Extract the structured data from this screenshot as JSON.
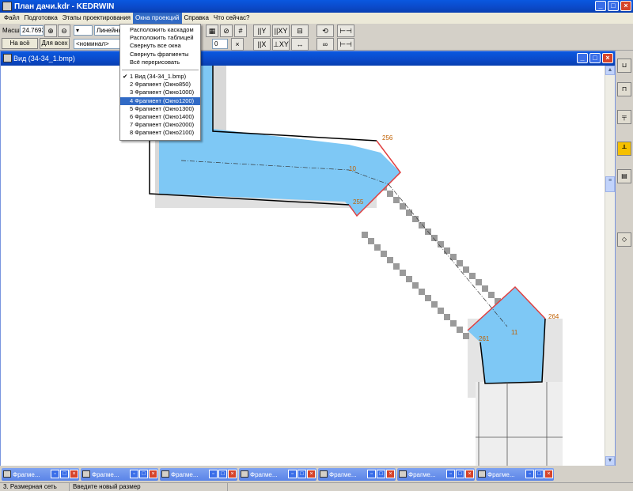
{
  "app": {
    "title": "План дачи.kdr - KEDRWIN"
  },
  "menu": [
    "Файл",
    "Подготовка",
    "Этапы проектирования",
    "Окна проекций",
    "Справка",
    "Что сейчас?"
  ],
  "toolbar": {
    "scale_label": "Масшт",
    "scale_value": "24.7693",
    "btn_all_window": "На всё окно",
    "btn_for_all": "Для всех",
    "linetype": "Линейный",
    "nominal": "<номинал>",
    "zero_value": "0"
  },
  "dropdown": {
    "items": [
      "Расположить каскадом",
      "Расположить таблицей",
      "Свернуть все окна",
      "Свернуть фрагменты",
      "Всё перерисовать"
    ],
    "windows": [
      "1 Вид (34-34_1.bmp)",
      "2 Фрагмент (Окно850)",
      "3 Фрагмент (Окно1000)",
      "4 Фрагмент (Окно1200)",
      "5 Фрагмент (Окно1300)",
      "6 Фрагмент (Окно1400)",
      "7 Фрагмент (Окно2000)",
      "8 Фрагмент (Окно2100)"
    ],
    "checked_index": 0,
    "selected_index": 3
  },
  "child_window": {
    "title": "Вид (34-34_1.bmp)"
  },
  "drawing": {
    "labels": [
      "256",
      "10",
      "255",
      "11",
      "264",
      "261"
    ]
  },
  "taskbar": {
    "items": [
      "Фрагме...",
      "Фрагме...",
      "Фрагме...",
      "Фрагме...",
      "Фрагме...",
      "Фрагме...",
      "Фрагме..."
    ]
  },
  "status": {
    "left": "3. Размерная сеть",
    "right": "Введите новый размер"
  },
  "colors": {
    "titlebar": "#0b49c8",
    "fill_blue": "#7ec8f5",
    "red_line": "#e04040",
    "selection": "#316ac5"
  }
}
